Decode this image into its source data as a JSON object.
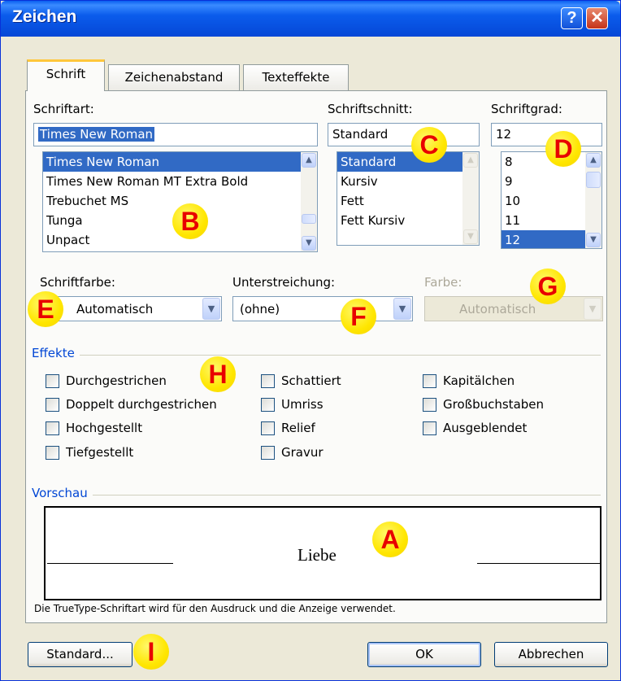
{
  "window": {
    "title": "Zeichen",
    "help_glyph": "?",
    "close_glyph": "✕"
  },
  "tabs": [
    {
      "label": "Schrift",
      "active": true
    },
    {
      "label": "Zeichenabstand",
      "active": false
    },
    {
      "label": "Texteffekte",
      "active": false
    }
  ],
  "font": {
    "label": "Schriftart:",
    "value": "Times New Roman",
    "items": [
      "Times New Roman",
      "Times New Roman MT Extra Bold",
      "Trebuchet MS",
      "Tunga",
      "Unpact"
    ],
    "selected_index": 0
  },
  "style": {
    "label": "Schriftschnitt:",
    "value": "Standard",
    "items": [
      "Standard",
      "Kursiv",
      "Fett",
      "Fett Kursiv"
    ],
    "selected_index": 0
  },
  "size": {
    "label": "Schriftgrad:",
    "value": "12",
    "items": [
      "8",
      "9",
      "10",
      "11",
      "12"
    ],
    "selected_index": 4
  },
  "color": {
    "label": "Schriftfarbe:",
    "value": "Automatisch"
  },
  "underline": {
    "label": "Unterstreichung:",
    "value": "(ohne)"
  },
  "underline_color": {
    "label": "Farbe:",
    "value": "Automatisch",
    "enabled": false
  },
  "effects": {
    "title": "Effekte",
    "col1": [
      "Durchgestrichen",
      "Doppelt durchgestrichen",
      "Hochgestellt",
      "Tiefgestellt"
    ],
    "col2": [
      "Schattiert",
      "Umriss",
      "Relief",
      "Gravur"
    ],
    "col3": [
      "Kapitälchen",
      "Großbuchstaben",
      "Ausgeblendet"
    ]
  },
  "preview": {
    "title": "Vorschau",
    "sample": "Liebe",
    "note": "Die TrueType-Schriftart wird für den Ausdruck und die Anzeige verwendet."
  },
  "buttons": {
    "default": "Standard...",
    "ok": "OK",
    "cancel": "Abbrechen"
  },
  "annotations": [
    "A",
    "B",
    "C",
    "D",
    "E",
    "F",
    "G",
    "H",
    "I"
  ],
  "colors": {
    "titlebar": "#0b5cec",
    "selection": "#316ac5",
    "group_title": "#0046d5",
    "marker_fill": "#ffe600",
    "marker_text": "#e80000"
  }
}
